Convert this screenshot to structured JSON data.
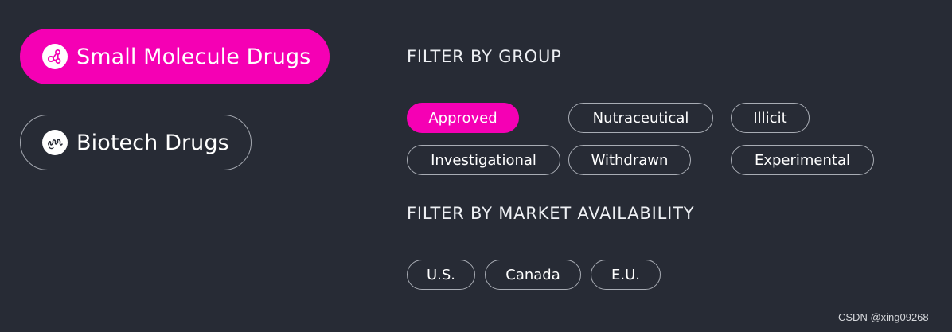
{
  "drug_types": {
    "small_molecule": {
      "label": "Small Molecule Drugs",
      "icon": "molecule-icon",
      "active": true
    },
    "biotech": {
      "label": "Biotech Drugs",
      "icon": "protein-icon",
      "active": false
    }
  },
  "filter_group": {
    "title": "FILTER BY GROUP",
    "options": {
      "approved": {
        "label": "Approved",
        "selected": true
      },
      "nutraceutical": {
        "label": "Nutraceutical",
        "selected": false
      },
      "illicit": {
        "label": "Illicit",
        "selected": false
      },
      "investigational": {
        "label": "Investigational",
        "selected": false
      },
      "withdrawn": {
        "label": "Withdrawn",
        "selected": false
      },
      "experimental": {
        "label": "Experimental",
        "selected": false
      }
    }
  },
  "filter_market": {
    "title": "FILTER BY MARKET AVAILABILITY",
    "options": {
      "us": {
        "label": "U.S.",
        "selected": false
      },
      "canada": {
        "label": "Canada",
        "selected": false
      },
      "eu": {
        "label": "E.U.",
        "selected": false
      }
    }
  },
  "watermark": "CSDN @xing09268",
  "colors": {
    "background": "#272b35",
    "accent": "#f500b4",
    "pill_border": "#a8acb4",
    "text": "#ffffff"
  }
}
